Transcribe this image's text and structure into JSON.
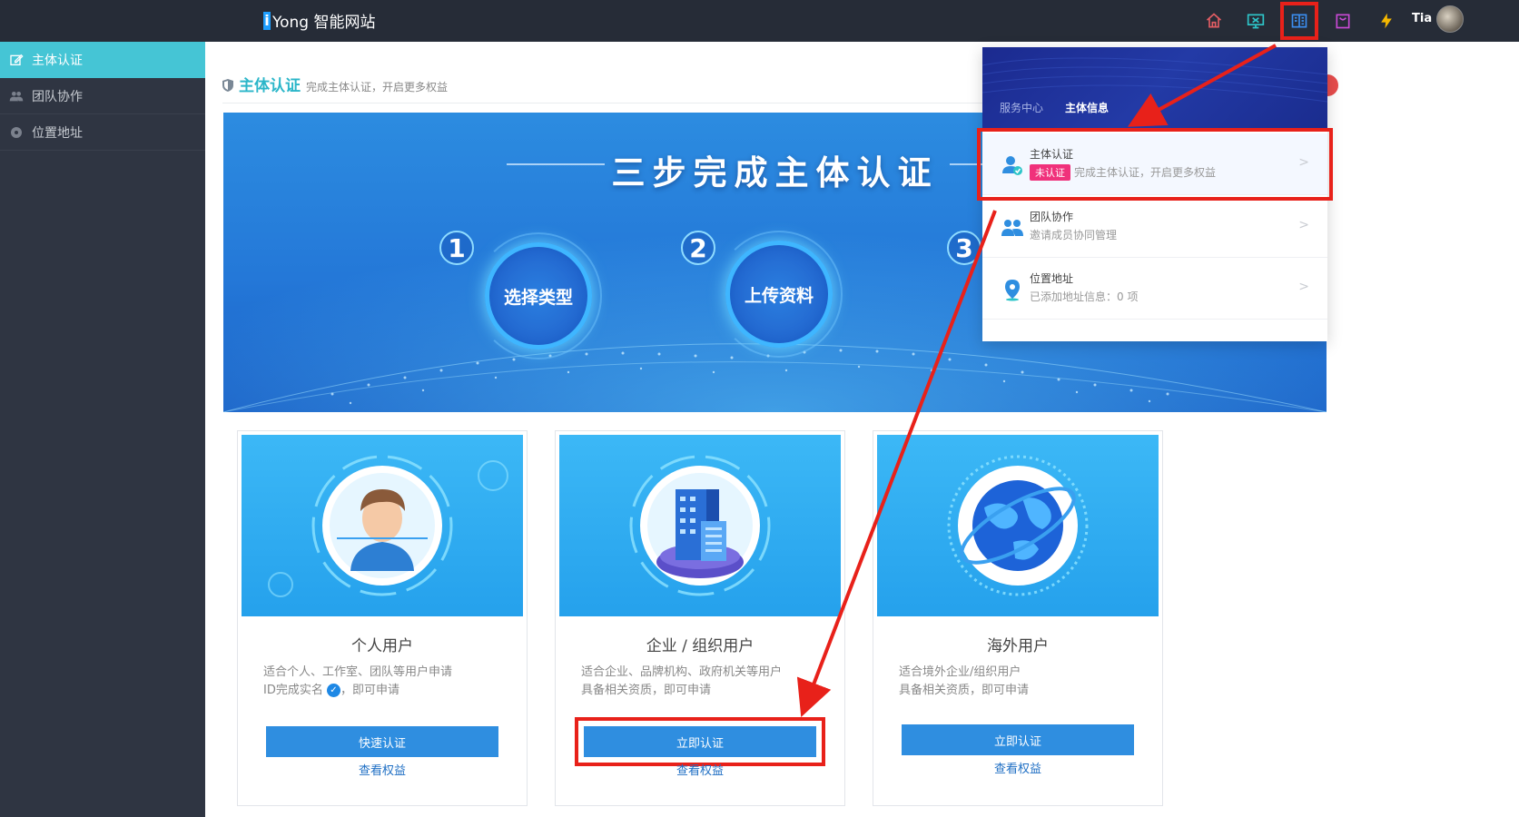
{
  "topbar": {
    "logo_mark": "i",
    "logo_text": "Yong 智能网站",
    "username": "Tia",
    "icons": [
      "home-icon",
      "monitor-icon",
      "book-icon",
      "bag-icon",
      "lightning-icon"
    ]
  },
  "sidebar": {
    "items": [
      {
        "label": "主体认证",
        "icon": "edit-icon",
        "active": true
      },
      {
        "label": "团队协作",
        "icon": "team-icon",
        "active": false
      },
      {
        "label": "位置地址",
        "icon": "location-icon",
        "active": false
      }
    ]
  },
  "header": {
    "title": "主体认证",
    "subtitle": "完成主体认证，开启更多权益"
  },
  "banner": {
    "title": "三步完成主体认证",
    "steps": [
      {
        "num": "1",
        "label": "选择类型"
      },
      {
        "num": "2",
        "label": "上传资料"
      },
      {
        "num": "3",
        "label": ""
      }
    ]
  },
  "cards": [
    {
      "title": "个人用户",
      "desc_line1": "适合个人、工作室、团队等用户申请",
      "desc_line2_pre": "ID完成实名",
      "desc_line2_post": "，即可申请",
      "button": "快速认证",
      "link": "查看权益"
    },
    {
      "title": "企业 / 组织用户",
      "desc_line1": "适合企业、品牌机构、政府机关等用户",
      "desc_line2": "具备相关资质，即可申请",
      "button": "立即认证",
      "link": "查看权益"
    },
    {
      "title": "海外用户",
      "desc_line1": "适合境外企业/组织用户",
      "desc_line2": "具备相关资质，即可申请",
      "button": "立即认证",
      "link": "查看权益"
    }
  ],
  "dropdown": {
    "crumb_parent": "服务中心",
    "crumb_current": "主体信息",
    "items": [
      {
        "title": "主体认证",
        "badge": "未认证",
        "desc": "完成主体认证，开启更多权益"
      },
      {
        "title": "团队协作",
        "desc": "邀请成员协同管理"
      },
      {
        "title": "位置地址",
        "desc": "已添加地址信息：0 项"
      }
    ],
    "chevron": ">"
  },
  "colors": {
    "accent": "#45c5d5",
    "topbar": "#262c37",
    "sidebar": "#2f3542",
    "button": "#2f8ee0",
    "highlight": "#e8211a",
    "badge": "#f0317b"
  }
}
